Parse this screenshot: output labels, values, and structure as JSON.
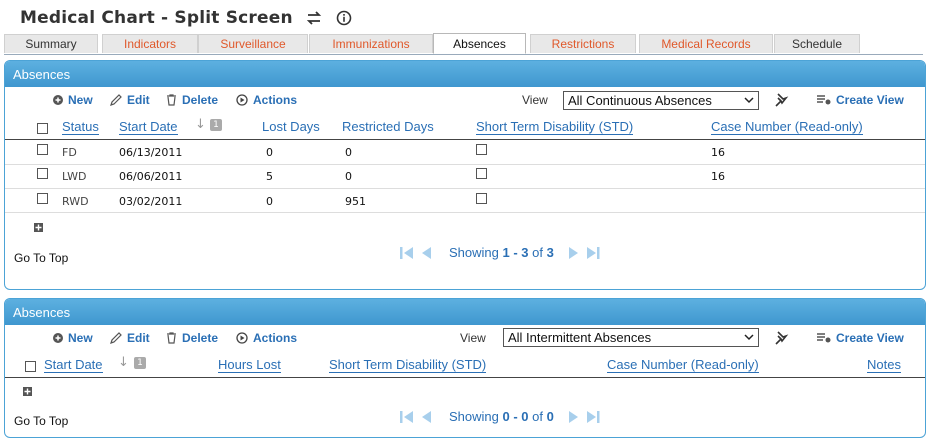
{
  "header": {
    "title": "Medical Chart - Split Screen"
  },
  "tabs": [
    {
      "label": "Summary",
      "style": "dark"
    },
    {
      "label": "Indicators",
      "style": "orange"
    },
    {
      "label": "Surveillance",
      "style": "orange"
    },
    {
      "label": "Immunizations",
      "style": "orange"
    },
    {
      "label": "Absences",
      "style": "active"
    },
    {
      "label": "Restrictions",
      "style": "orange"
    },
    {
      "label": "Medical Records",
      "style": "orange"
    },
    {
      "label": "Schedule",
      "style": "dark"
    }
  ],
  "toolbar": {
    "new": "New",
    "edit": "Edit",
    "delete": "Delete",
    "actions": "Actions",
    "view_label": "View",
    "create_view": "Create View"
  },
  "panel1": {
    "title": "Absences",
    "view_value": "All Continuous Absences",
    "columns": [
      "Status",
      "Start Date",
      "Lost Days",
      "Restricted Days",
      "Short Term Disability (STD)",
      "Case Number (Read-only)"
    ],
    "sort_badge": "1",
    "rows": [
      {
        "status": "FD",
        "start": "06/13/2011",
        "lost": "0",
        "restricted": "0",
        "case": "16"
      },
      {
        "status": "LWD",
        "start": "06/06/2011",
        "lost": "5",
        "restricted": "0",
        "case": "16"
      },
      {
        "status": "RWD",
        "start": "03/02/2011",
        "lost": "0",
        "restricted": "951",
        "case": ""
      }
    ],
    "go_top": "Go To Top",
    "pager": {
      "prefix": "Showing ",
      "range": "1 - 3",
      "of": " of ",
      "total": "3"
    }
  },
  "panel2": {
    "title": "Absences",
    "view_value": "All Intermittent Absences",
    "columns": [
      "Start Date",
      "Hours Lost",
      "Short Term Disability (STD)",
      "Case Number (Read-only)",
      "Notes"
    ],
    "sort_badge": "1",
    "go_top": "Go To Top",
    "pager": {
      "prefix": "Showing ",
      "range": "0 - 0",
      "of": " of ",
      "total": "0"
    }
  },
  "colors": {
    "accent": "#3f97cf",
    "link": "#2a6fb5",
    "tab_orange": "#e0582a"
  }
}
